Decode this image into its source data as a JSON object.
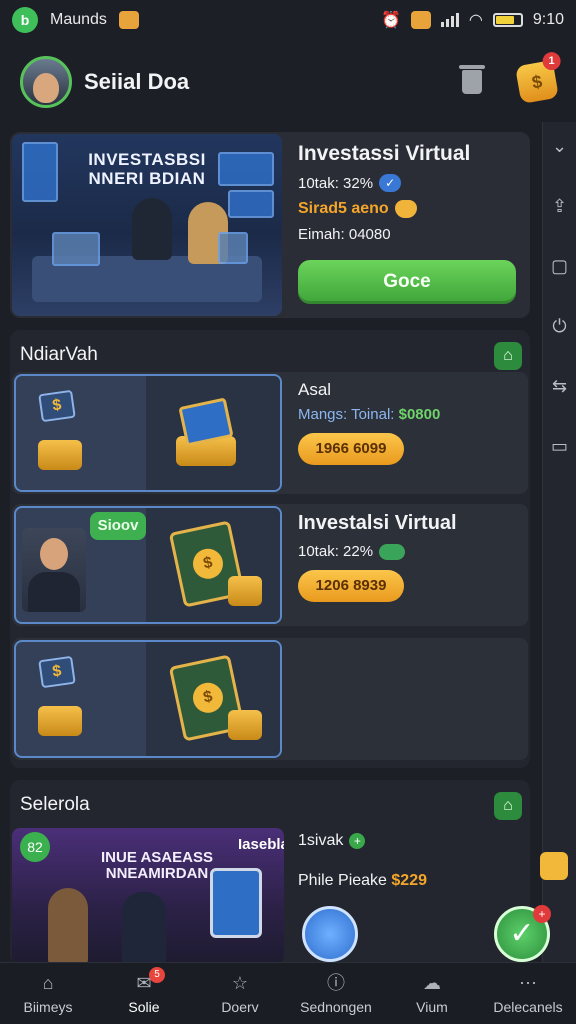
{
  "status_bar": {
    "app_initial": "b",
    "carrier": "Maunds",
    "time": "9:10"
  },
  "header": {
    "title": "Seiial Doa",
    "notification_count": "1",
    "coin_symbol": "$"
  },
  "hero": {
    "banner_text": "INVESTASBSI NNERI BDIAN",
    "title": "Investassi Virtual",
    "line1": "10tak: 32%",
    "line2": "Sirad5 aeno",
    "line3": "Eimah: 04080",
    "button_label": "Goce"
  },
  "section_a": {
    "title": "NdiarVah",
    "items": [
      {
        "label": "Asal",
        "sub_label": "Mangs: Toinal:",
        "sub_value": "$0800",
        "amount": "1966 6099"
      },
      {
        "tag": "Sioov",
        "title": "Investalsi Virtual",
        "line": "10tak: 22%",
        "amount": "1206 8939"
      },
      {}
    ]
  },
  "section_b": {
    "title": "Selerola",
    "badge_num": "82",
    "banner_text": "INUE ASAEASS NNEAMIRDAN",
    "corner_text": "Iasebla",
    "label": "1sivak",
    "price_label": "Phile Pieake",
    "price": "$229"
  },
  "bottom_nav": [
    {
      "label": "Biimeys",
      "icon": "home-icon"
    },
    {
      "label": "Solie",
      "icon": "chat-icon",
      "badge": "5",
      "active": true
    },
    {
      "label": "Doerv",
      "icon": "star-icon"
    },
    {
      "label": "Sednongen",
      "icon": "info-icon"
    },
    {
      "label": "Vium",
      "icon": "cloud-icon"
    },
    {
      "label": "Delecanels",
      "icon": "grid-icon"
    }
  ],
  "colors": {
    "background": "#1c1f26",
    "accent_green": "#3fa43a",
    "accent_orange": "#f4a62a",
    "accent_blue": "#3a78d6"
  }
}
